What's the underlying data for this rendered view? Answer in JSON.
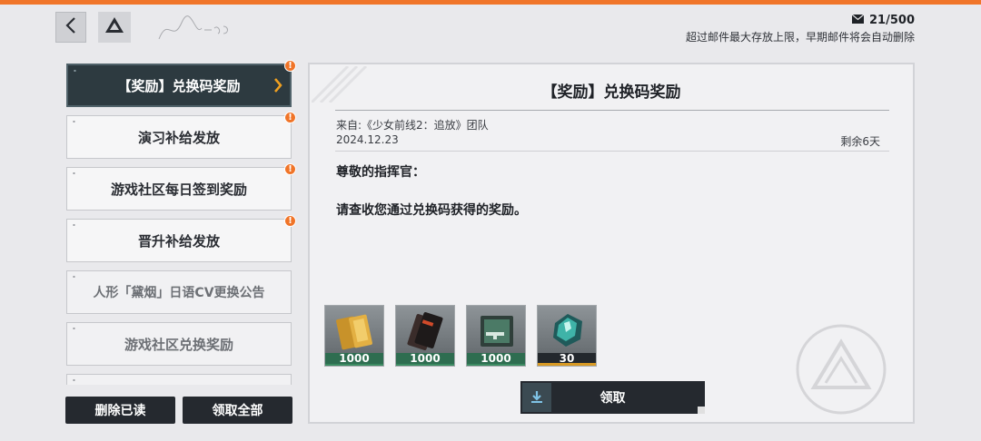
{
  "mail_counter": {
    "value": "21/500",
    "icon": "envelope-icon"
  },
  "mail_note": "超过邮件最大存放上限，早期邮件将会自动删除",
  "nav": {
    "back_icon": "chevron-left-icon",
    "home_icon": "triangle-logo-icon"
  },
  "mail_list": [
    {
      "title": "【奖励】兑换码奖励",
      "state": "active",
      "unread": true
    },
    {
      "title": "演习补给发放",
      "state": "normal",
      "unread": true
    },
    {
      "title": "游戏社区每日签到奖励",
      "state": "normal",
      "unread": true
    },
    {
      "title": "晋升补给发放",
      "state": "normal",
      "unread": true
    },
    {
      "title": "人形「黛烟」日语CV更换公告",
      "state": "read",
      "unread": false
    },
    {
      "title": "游戏社区兑换奖励",
      "state": "read",
      "unread": false
    }
  ],
  "badge_text": "!",
  "actions": {
    "delete_read": "删除已读",
    "claim_all": "领取全部"
  },
  "mail": {
    "title": "【奖励】兑换码奖励",
    "sender": "来自:《少女前线2：追放》团队",
    "date": "2024.12.23",
    "remaining": "剩余6天",
    "greeting": "尊敬的指挥官：",
    "body": "请查收您通过兑换码获得的奖励。"
  },
  "rewards": [
    {
      "name": "gold-bar-item",
      "qty": "1000",
      "rarity": "green"
    },
    {
      "name": "ticket-item",
      "qty": "1000",
      "rarity": "green"
    },
    {
      "name": "weapon-card-item",
      "qty": "1000",
      "rarity": "green"
    },
    {
      "name": "crystal-item",
      "qty": "30",
      "rarity": "gold"
    }
  ],
  "claim_button": {
    "label": "领取",
    "icon": "download-icon"
  },
  "colors": {
    "accent": "#f0752a",
    "dark": "#25292f",
    "active_item": "#2d3a40",
    "chevron": "#f0a020"
  }
}
